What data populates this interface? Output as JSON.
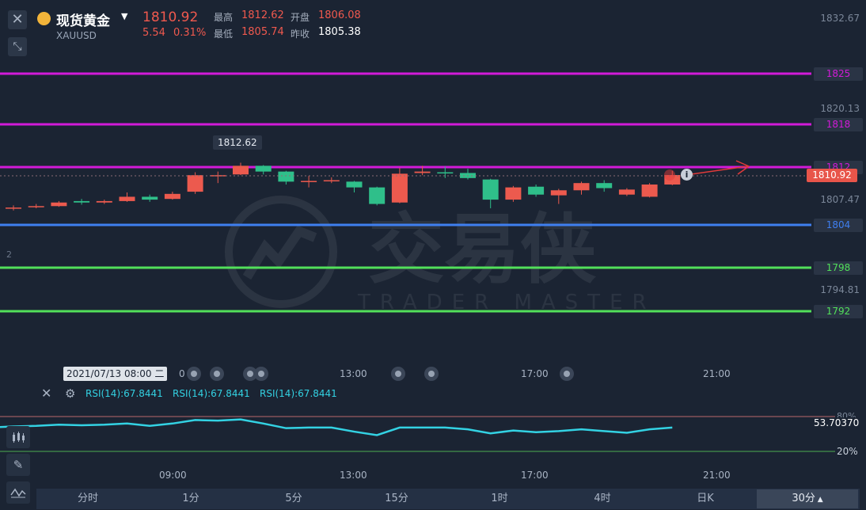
{
  "header": {
    "name": "现货黄金",
    "symbol": "XAUUSD",
    "price": "1810.92",
    "change": "5.54",
    "change_pct": "0.31%",
    "high_label": "最高",
    "high": "1812.62",
    "low_label": "最低",
    "low": "1805.74",
    "open_label": "开盘",
    "open": "1806.08",
    "prev_label": "昨收",
    "prev": "1805.38"
  },
  "chart": {
    "y_ticks": [
      "1832.67",
      "1820.13",
      "1807.47",
      "1794.81"
    ],
    "hlines": [
      {
        "label": "1825",
        "price": 1825,
        "color": "#d21ad8"
      },
      {
        "label": "1818",
        "price": 1818,
        "color": "#d21ad8"
      },
      {
        "label": "1812",
        "price": 1812,
        "color": "#d21ad8"
      },
      {
        "label": "1804",
        "price": 1804,
        "color": "#3f7ff0"
      },
      {
        "label": "1798",
        "price": 1798,
        "color": "#52e05a"
      },
      {
        "label": "1792",
        "price": 1792,
        "color": "#52e05a"
      }
    ],
    "current_price_tag": "1810.92",
    "high_marker": "1812.62",
    "left_partial_label": "2",
    "crosshair_date": "2021/07/13 08:00 二",
    "crosshair_suffix": "0",
    "x_ticks_top": [
      "13:00",
      "17:00",
      "21:00"
    ],
    "x_ticks_bottom": [
      "09:00",
      "13:00",
      "17:00",
      "21:00"
    ],
    "watermark_cn": "交易侠",
    "watermark_en": "TRADER MASTER",
    "candles": [
      {
        "o": 1806.3,
        "c": 1806.4,
        "h": 1806.7,
        "l": 1806.0
      },
      {
        "o": 1806.5,
        "c": 1806.6,
        "h": 1806.9,
        "l": 1806.3
      },
      {
        "o": 1806.6,
        "c": 1807.1,
        "h": 1807.3,
        "l": 1806.5
      },
      {
        "o": 1807.3,
        "c": 1807.1,
        "h": 1807.6,
        "l": 1806.8
      },
      {
        "o": 1807.1,
        "c": 1807.3,
        "h": 1807.5,
        "l": 1806.9
      },
      {
        "o": 1807.3,
        "c": 1807.9,
        "h": 1808.5,
        "l": 1807.2
      },
      {
        "o": 1807.9,
        "c": 1807.5,
        "h": 1808.2,
        "l": 1807.2
      },
      {
        "o": 1807.6,
        "c": 1808.3,
        "h": 1808.6,
        "l": 1807.5
      },
      {
        "o": 1808.6,
        "c": 1810.9,
        "h": 1811.3,
        "l": 1808.3
      },
      {
        "o": 1810.9,
        "c": 1810.9,
        "h": 1811.4,
        "l": 1809.8
      },
      {
        "o": 1811.0,
        "c": 1812.2,
        "h": 1812.62,
        "l": 1810.9
      },
      {
        "o": 1812.2,
        "c": 1811.4,
        "h": 1812.3,
        "l": 1811.0
      },
      {
        "o": 1811.4,
        "c": 1810.0,
        "h": 1811.5,
        "l": 1809.6
      },
      {
        "o": 1810.0,
        "c": 1810.1,
        "h": 1810.8,
        "l": 1809.2
      },
      {
        "o": 1810.2,
        "c": 1810.2,
        "h": 1810.6,
        "l": 1809.8
      },
      {
        "o": 1810.0,
        "c": 1809.2,
        "h": 1810.1,
        "l": 1808.5
      },
      {
        "o": 1809.2,
        "c": 1806.9,
        "h": 1809.3,
        "l": 1806.7
      },
      {
        "o": 1807.1,
        "c": 1811.1,
        "h": 1811.9,
        "l": 1807.0
      },
      {
        "o": 1811.2,
        "c": 1811.4,
        "h": 1812.2,
        "l": 1810.9
      },
      {
        "o": 1811.3,
        "c": 1811.2,
        "h": 1812.1,
        "l": 1810.5
      },
      {
        "o": 1811.2,
        "c": 1810.5,
        "h": 1811.8,
        "l": 1810.3
      },
      {
        "o": 1810.3,
        "c": 1807.5,
        "h": 1810.4,
        "l": 1806.3
      },
      {
        "o": 1807.5,
        "c": 1809.2,
        "h": 1809.4,
        "l": 1807.2
      },
      {
        "o": 1809.3,
        "c": 1808.2,
        "h": 1809.6,
        "l": 1807.9
      },
      {
        "o": 1808.1,
        "c": 1808.8,
        "h": 1809.0,
        "l": 1806.9
      },
      {
        "o": 1808.8,
        "c": 1809.8,
        "h": 1810.0,
        "l": 1808.2
      },
      {
        "o": 1809.8,
        "c": 1809.1,
        "h": 1810.2,
        "l": 1808.6
      },
      {
        "o": 1808.2,
        "c": 1808.9,
        "h": 1809.1,
        "l": 1808.0
      },
      {
        "o": 1807.9,
        "c": 1809.6,
        "h": 1809.8,
        "l": 1807.8
      },
      {
        "o": 1809.6,
        "c": 1810.92,
        "h": 1811.5,
        "l": 1809.5
      }
    ],
    "candle_up_color": "#ec5a4e",
    "candle_down_color": "#2fbf8a"
  },
  "rsi": {
    "labels": [
      "RSI(14):67.8441",
      "RSI(14):67.8441",
      "RSI(14):67.8441"
    ],
    "level_20": "20%",
    "level_80": "80%",
    "current_value": "53.70370",
    "values": [
      63,
      64,
      66,
      65,
      66,
      68,
      64,
      68,
      74,
      73,
      75,
      68,
      60,
      61,
      61,
      54,
      48,
      61,
      61,
      61,
      58,
      51,
      56,
      53,
      55,
      58,
      55,
      52,
      58,
      61
    ],
    "line_color": "#33d2e3"
  },
  "timeframes": {
    "items": [
      "分时",
      "1分",
      "5分",
      "15分",
      "1时",
      "4时",
      "日K"
    ],
    "active": "30分"
  },
  "colors": {
    "background": "#1b2433",
    "up": "#f0594e",
    "rsi_line": "#33d2e3"
  }
}
